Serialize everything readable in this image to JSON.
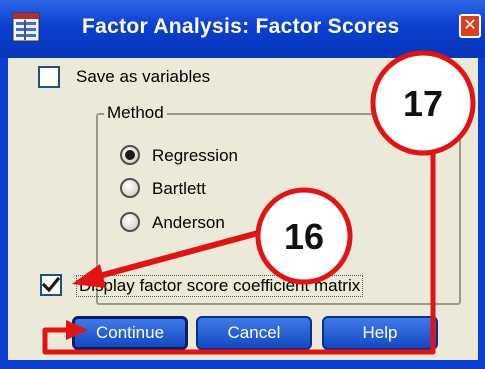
{
  "window": {
    "title": "Factor Analysis: Factor Scores",
    "close_symbol": "✕"
  },
  "save_variables": {
    "label": "Save as variables",
    "checked": false
  },
  "method": {
    "legend": "Method",
    "options": [
      {
        "label": "Regression",
        "selected": true
      },
      {
        "label": "Bartlett",
        "selected": false
      },
      {
        "label": "Anderson",
        "selected": false
      }
    ]
  },
  "display_matrix": {
    "label": "Display factor score coefficient matrix",
    "checked": true
  },
  "buttons": {
    "continue": "Continue",
    "cancel": "Cancel",
    "help": "Help"
  },
  "annotations": {
    "callout_a": "17",
    "callout_b": "16",
    "color": "#e01414"
  },
  "colors": {
    "titlebar": "#0b3fcf",
    "dialog_bg": "#ece9d8",
    "button": "#1f55d0"
  }
}
